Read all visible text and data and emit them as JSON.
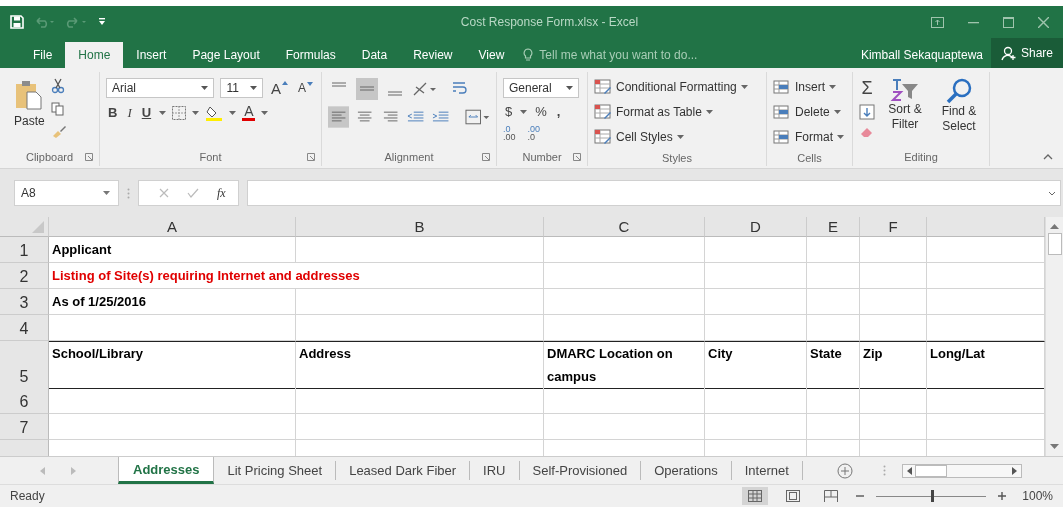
{
  "title_bar": {
    "title": "Cost Response Form.xlsx - Excel"
  },
  "ribbon_tabs": [
    {
      "label": "File",
      "selected": false
    },
    {
      "label": "Home",
      "selected": true
    },
    {
      "label": "Insert",
      "selected": false
    },
    {
      "label": "Page Layout",
      "selected": false
    },
    {
      "label": "Formulas",
      "selected": false
    },
    {
      "label": "Data",
      "selected": false
    },
    {
      "label": "Review",
      "selected": false
    },
    {
      "label": "View",
      "selected": false
    }
  ],
  "tell_me": {
    "placeholder": "Tell me what you want to do..."
  },
  "user": "Kimball Sekaquaptewa",
  "share": "Share",
  "ribbon": {
    "clipboard": {
      "label": "Clipboard",
      "paste": "Paste"
    },
    "font": {
      "label": "Font",
      "name": "Arial",
      "size": "11",
      "grow": "A",
      "shrink": "A",
      "bold": "B",
      "italic": "I",
      "underline": "U",
      "font_color": "A"
    },
    "alignment": {
      "label": "Alignment"
    },
    "number": {
      "label": "Number",
      "format": "General",
      "currency": "$",
      "percent": "%",
      "comma": ",",
      "decimals": [
        {
          "top": ".0",
          "bottom": ".00"
        },
        {
          "top": ".00",
          "bottom": ".0"
        }
      ]
    },
    "styles": {
      "label": "Styles",
      "items": [
        "Conditional Formatting",
        "Format as Table",
        "Cell Styles"
      ]
    },
    "cells": {
      "label": "Cells",
      "items": [
        "Insert",
        "Delete",
        "Format"
      ]
    },
    "editing": {
      "label": "Editing",
      "autosum": "Σ",
      "sort": "Sort & Filter",
      "find": "Find & Select"
    }
  },
  "formula_bar": {
    "name_box": "A8",
    "fx": "fx"
  },
  "columns": [
    "A",
    "B",
    "C",
    "D",
    "E",
    "F"
  ],
  "rows": [
    {
      "header": "1",
      "kind": "normal",
      "cells": [
        {
          "text": "Applicant"
        },
        {
          "text": ""
        },
        {
          "text": ""
        },
        {
          "text": ""
        },
        {
          "text": ""
        },
        {
          "text": ""
        },
        {
          "text": ""
        }
      ]
    },
    {
      "header": "2",
      "kind": "normal",
      "cells": [
        {
          "text": "Listing of Site(s) requiring Internet and addresses",
          "color": "#e00000",
          "overflows": true
        },
        {
          "text": ""
        },
        {
          "text": ""
        },
        {
          "text": ""
        },
        {
          "text": ""
        },
        {
          "text": ""
        }
      ]
    },
    {
      "header": "3",
      "kind": "normal",
      "cells": [
        {
          "text": "As of 1/25/2016"
        },
        {
          "text": ""
        },
        {
          "text": ""
        },
        {
          "text": ""
        },
        {
          "text": ""
        },
        {
          "text": ""
        },
        {
          "text": ""
        }
      ]
    },
    {
      "header": "4",
      "kind": "normal",
      "cells": [
        {
          "text": ""
        },
        {
          "text": ""
        },
        {
          "text": ""
        },
        {
          "text": ""
        },
        {
          "text": ""
        },
        {
          "text": ""
        },
        {
          "text": ""
        }
      ]
    },
    {
      "header": "5",
      "kind": "header",
      "cells": [
        {
          "text": "School/Library"
        },
        {
          "text": "Address"
        },
        {
          "text": "DMARC Location on campus"
        },
        {
          "text": "City"
        },
        {
          "text": "State"
        },
        {
          "text": "Zip"
        },
        {
          "text": "Long/Lat"
        }
      ]
    },
    {
      "header": "6",
      "kind": "normal",
      "cells": [
        {
          "text": ""
        },
        {
          "text": ""
        },
        {
          "text": ""
        },
        {
          "text": ""
        },
        {
          "text": ""
        },
        {
          "text": ""
        },
        {
          "text": ""
        }
      ]
    },
    {
      "header": "7",
      "kind": "normal",
      "cells": [
        {
          "text": ""
        },
        {
          "text": ""
        },
        {
          "text": ""
        },
        {
          "text": ""
        },
        {
          "text": ""
        },
        {
          "text": ""
        },
        {
          "text": ""
        }
      ]
    },
    {
      "header": "",
      "kind": "partial",
      "cells": [
        {
          "text": ""
        },
        {
          "text": ""
        },
        {
          "text": ""
        },
        {
          "text": ""
        },
        {
          "text": ""
        },
        {
          "text": ""
        },
        {
          "text": ""
        }
      ]
    }
  ],
  "sheet_tabs": [
    {
      "label": "Addresses",
      "selected": true
    },
    {
      "label": "Lit Pricing Sheet",
      "selected": false
    },
    {
      "label": "Leased Dark Fiber",
      "selected": false
    },
    {
      "label": "IRU",
      "selected": false
    },
    {
      "label": "Self-Provisioned",
      "selected": false
    },
    {
      "label": "Operations",
      "selected": false
    },
    {
      "label": "Internet",
      "selected": false
    }
  ],
  "status_bar": {
    "status": "Ready",
    "views": [
      {
        "kind": "normal",
        "selected": true
      },
      {
        "kind": "page_layout",
        "selected": false
      },
      {
        "kind": "page_break",
        "selected": false
      }
    ],
    "zoom": {
      "level": 0.5,
      "reading": "100%"
    }
  }
}
